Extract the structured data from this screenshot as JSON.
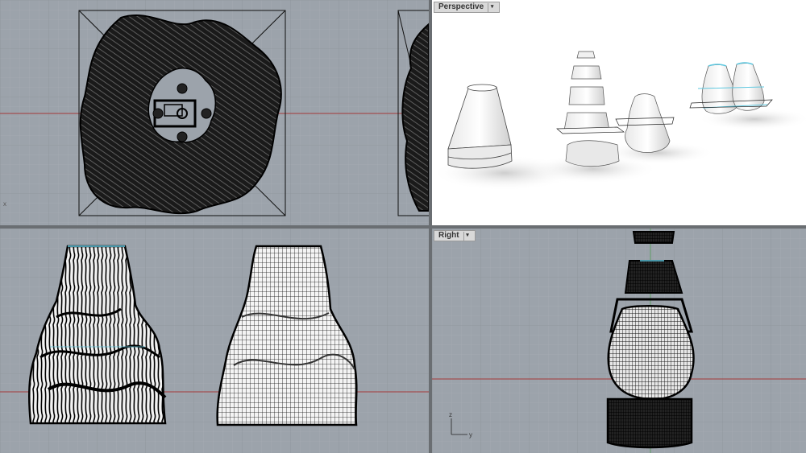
{
  "viewports": [
    {
      "id": "top",
      "label": "",
      "axis_x": "x",
      "axis_y": ""
    },
    {
      "id": "perspective",
      "label": "Perspective"
    },
    {
      "id": "front",
      "label": ""
    },
    {
      "id": "right",
      "label": "Right",
      "axis_x": "y",
      "axis_y": "z"
    }
  ],
  "icons": {
    "viewport_menu": "chevron-down-icon"
  },
  "colors": {
    "viewport_bg": "#9ca3ab",
    "grid_minor": "#a7adb4",
    "grid_major": "#8d939a",
    "x_axis": "#a33a3a",
    "y_axis": "#3a9a3a",
    "wire": "#111111",
    "perspective_bg": "#ffffff",
    "accent_cyan": "#5fc8e0"
  }
}
